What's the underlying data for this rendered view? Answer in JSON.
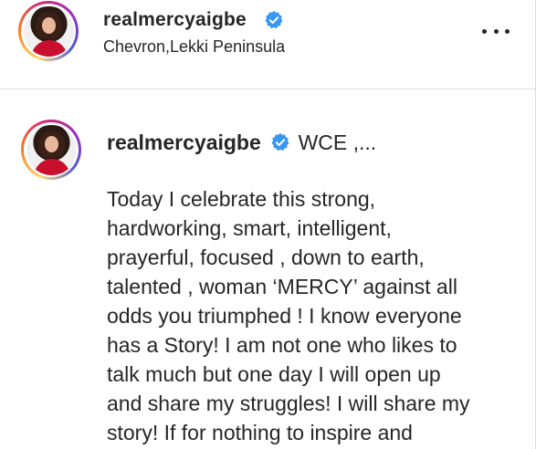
{
  "header": {
    "username": "realmercyaigbe",
    "location": "Chevron,Lekki Peninsula",
    "avatar_icon": "profile-photo",
    "verified_icon": "verified-badge-icon",
    "more_icon": "more-options-icon"
  },
  "caption": {
    "username": "realmercyaigbe",
    "intro": "WCE ,...",
    "lines": [
      "Today I celebrate this strong,",
      "hardworking, smart, intelligent,",
      "prayerful, focused , down to earth,",
      "talented , woman ‘MERCY’ against all",
      "odds you triumphed ! I know everyone",
      "has a Story! I am not one who likes to",
      "talk much but one day I will open up",
      "and share my struggles! I will share my",
      "story! If for nothing to inspire and"
    ]
  },
  "colors": {
    "verified": "#3897f0",
    "text": "#262626",
    "border": "#dbdbdb"
  }
}
